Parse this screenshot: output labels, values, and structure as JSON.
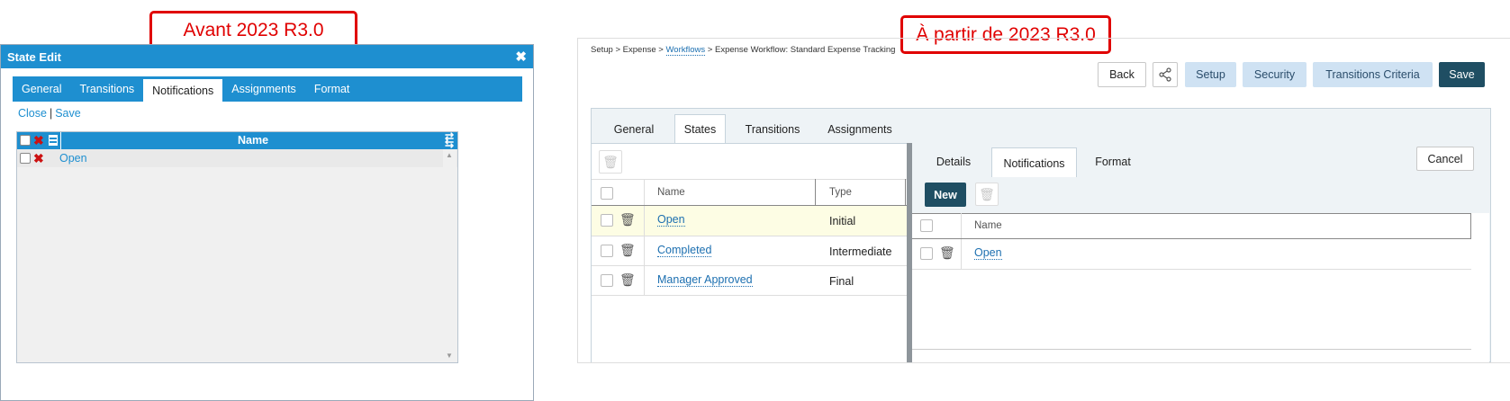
{
  "callouts": {
    "before": "Avant 2023 R3.0",
    "after": "À partir de 2023 R3.0"
  },
  "old_dialog": {
    "title": "State Edit",
    "close_icon": "close-icon",
    "tabs": [
      "General",
      "Transitions",
      "Notifications",
      "Assignments",
      "Format"
    ],
    "active_tab": "Notifications",
    "actions": {
      "close": "Close",
      "separator": "|",
      "save": "Save"
    },
    "grid": {
      "column_name": "Name",
      "rows": [
        {
          "name": "Open"
        }
      ]
    }
  },
  "new_screen": {
    "breadcrumb": {
      "parts": [
        "Setup",
        "Expense",
        "Workflows",
        "Expense Workflow: Standard Expense Tracking"
      ],
      "separator": ">"
    },
    "toolbar": {
      "back": "Back",
      "share_icon": "share-icon",
      "setup": "Setup",
      "security": "Security",
      "transitions_criteria": "Transitions Criteria",
      "save": "Save"
    },
    "tabs": [
      "General",
      "States",
      "Transitions",
      "Assignments"
    ],
    "active_tab": "States",
    "states_grid": {
      "columns": {
        "name": "Name",
        "type": "Type"
      },
      "rows": [
        {
          "name": "Open",
          "type": "Initial"
        },
        {
          "name": "Completed",
          "type": "Intermediate"
        },
        {
          "name": "Manager Approved",
          "type": "Final"
        }
      ]
    },
    "detail_tabs": [
      "Details",
      "Notifications",
      "Format"
    ],
    "active_detail_tab": "Notifications",
    "cancel": "Cancel",
    "new_button": "New",
    "notifications_grid": {
      "column_name": "Name",
      "rows": [
        {
          "name": "Open"
        }
      ]
    }
  }
}
